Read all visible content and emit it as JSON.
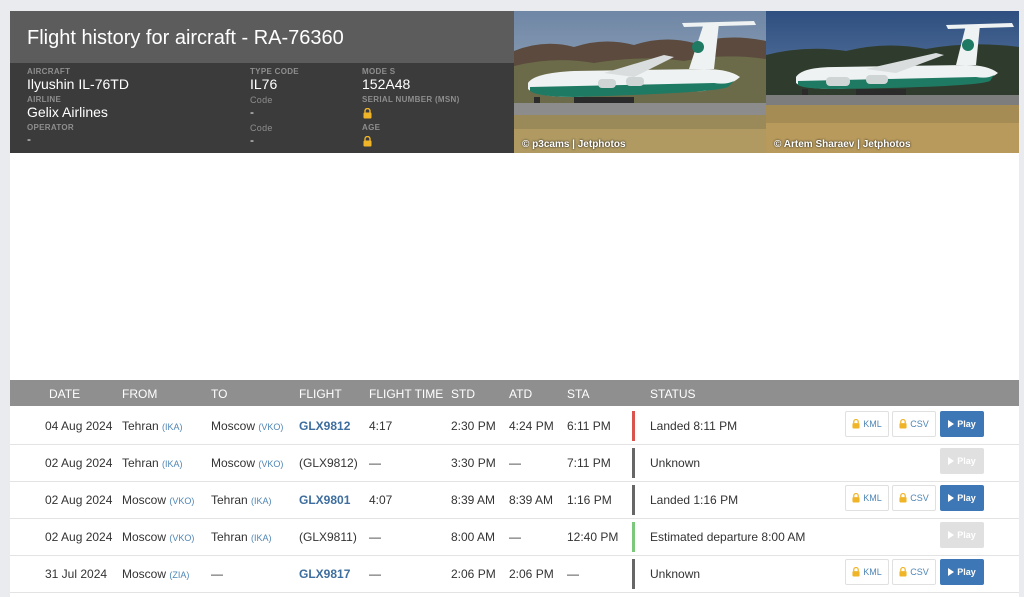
{
  "header": {
    "title": "Flight history for aircraft - RA-76360",
    "aircraft": {
      "label": "AIRCRAFT",
      "value": "Ilyushin IL-76TD"
    },
    "type_code": {
      "label": "TYPE CODE",
      "value": "IL76"
    },
    "mode_s": {
      "label": "MODE S",
      "value": "152A48"
    },
    "airline": {
      "label": "AIRLINE",
      "value": "Gelix Airlines"
    },
    "airline_code": {
      "label": "Code",
      "value": "-"
    },
    "serial": {
      "label": "SERIAL NUMBER (MSN)"
    },
    "operator": {
      "label": "OPERATOR",
      "value": "-"
    },
    "operator_code": {
      "label": "Code",
      "value": "-"
    },
    "age": {
      "label": "AGE"
    }
  },
  "photos": [
    {
      "credit": "© p3cams | Jetphotos"
    },
    {
      "credit": "© Artem Sharaev | Jetphotos"
    }
  ],
  "table": {
    "columns": [
      "DATE",
      "FROM",
      "TO",
      "FLIGHT",
      "FLIGHT TIME",
      "STD",
      "ATD",
      "STA",
      "STATUS"
    ],
    "kml_label": "KML",
    "csv_label": "CSV",
    "play_label": "Play",
    "rows": [
      {
        "date": "04 Aug 2024",
        "from": "Tehran",
        "from_code": "(IKA)",
        "to": "Moscow",
        "to_code": "(VKO)",
        "flight": "GLX9812",
        "flight_time": "4:17",
        "std": "2:30 PM",
        "atd": "4:24 PM",
        "sta": "6:11 PM",
        "status": "Landed 8:11 PM",
        "status_color": "#d9534f"
      },
      {
        "date": "02 Aug 2024",
        "from": "Tehran",
        "from_code": "(IKA)",
        "to": "Moscow",
        "to_code": "(VKO)",
        "flight": "(GLX9812)",
        "flight_time": "—",
        "std": "3:30 PM",
        "atd": "—",
        "sta": "7:11 PM",
        "status": "Unknown",
        "status_color": "#666666"
      },
      {
        "date": "02 Aug 2024",
        "from": "Moscow",
        "from_code": "(VKO)",
        "to": "Tehran",
        "to_code": "(IKA)",
        "flight": "GLX9801",
        "flight_time": "4:07",
        "std": "8:39 AM",
        "atd": "8:39 AM",
        "sta": "1:16 PM",
        "status": "Landed 1:16 PM",
        "status_color": "#666666"
      },
      {
        "date": "02 Aug 2024",
        "from": "Moscow",
        "from_code": "(VKO)",
        "to": "Tehran",
        "to_code": "(IKA)",
        "flight": "(GLX9811)",
        "flight_time": "—",
        "std": "8:00 AM",
        "atd": "—",
        "sta": "12:40 PM",
        "status": "Estimated departure 8:00 AM",
        "status_color": "#7dc77d"
      },
      {
        "date": "31 Jul 2024",
        "from": "Moscow",
        "from_code": "(ZIA)",
        "to": "—",
        "to_code": "",
        "flight": "GLX9817",
        "flight_time": "—",
        "std": "2:06 PM",
        "atd": "2:06 PM",
        "sta": "—",
        "status": "Unknown",
        "status_color": "#666666"
      }
    ]
  }
}
